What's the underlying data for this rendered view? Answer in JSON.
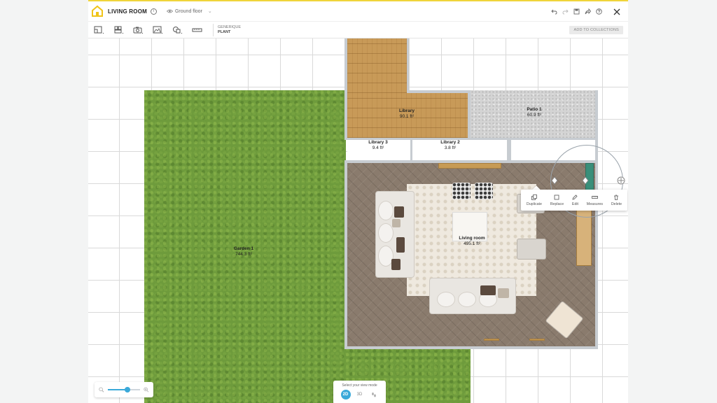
{
  "header": {
    "title": "LIVING ROOM",
    "floor": "Ground floor"
  },
  "toolbar": {
    "selection_brand": "GENERIQUE",
    "selection_name": "PLANT",
    "add_to_collections": "ADD TO COLLECTIONS"
  },
  "rooms": [
    {
      "name": "Library",
      "area": "90.1 ft²"
    },
    {
      "name": "Patio 1",
      "area": "60.9 ft²"
    },
    {
      "name": "Library 3",
      "area": "9.4 ft²"
    },
    {
      "name": "Library 2",
      "area": "3.8 ft²"
    },
    {
      "name": "Living room",
      "area": "495.1 ft²"
    },
    {
      "name": "Garden 1",
      "area": "744.3 ft²"
    }
  ],
  "context_menu": {
    "items": [
      {
        "label": "Duplicate",
        "icon": "duplicate-icon"
      },
      {
        "label": "Replace",
        "icon": "replace-icon"
      },
      {
        "label": "Edit",
        "icon": "pencil-icon"
      },
      {
        "label": "Measures",
        "icon": "ruler-icon"
      },
      {
        "label": "Delete",
        "icon": "trash-icon"
      }
    ]
  },
  "zoom": {
    "level": 0.6
  },
  "view_mode": {
    "caption": "Select your view mode",
    "modes": [
      "2D",
      "3D"
    ],
    "active": "2D"
  },
  "colors": {
    "accent": "#3ba9d9",
    "brand_yellow": "#f0d43a"
  }
}
